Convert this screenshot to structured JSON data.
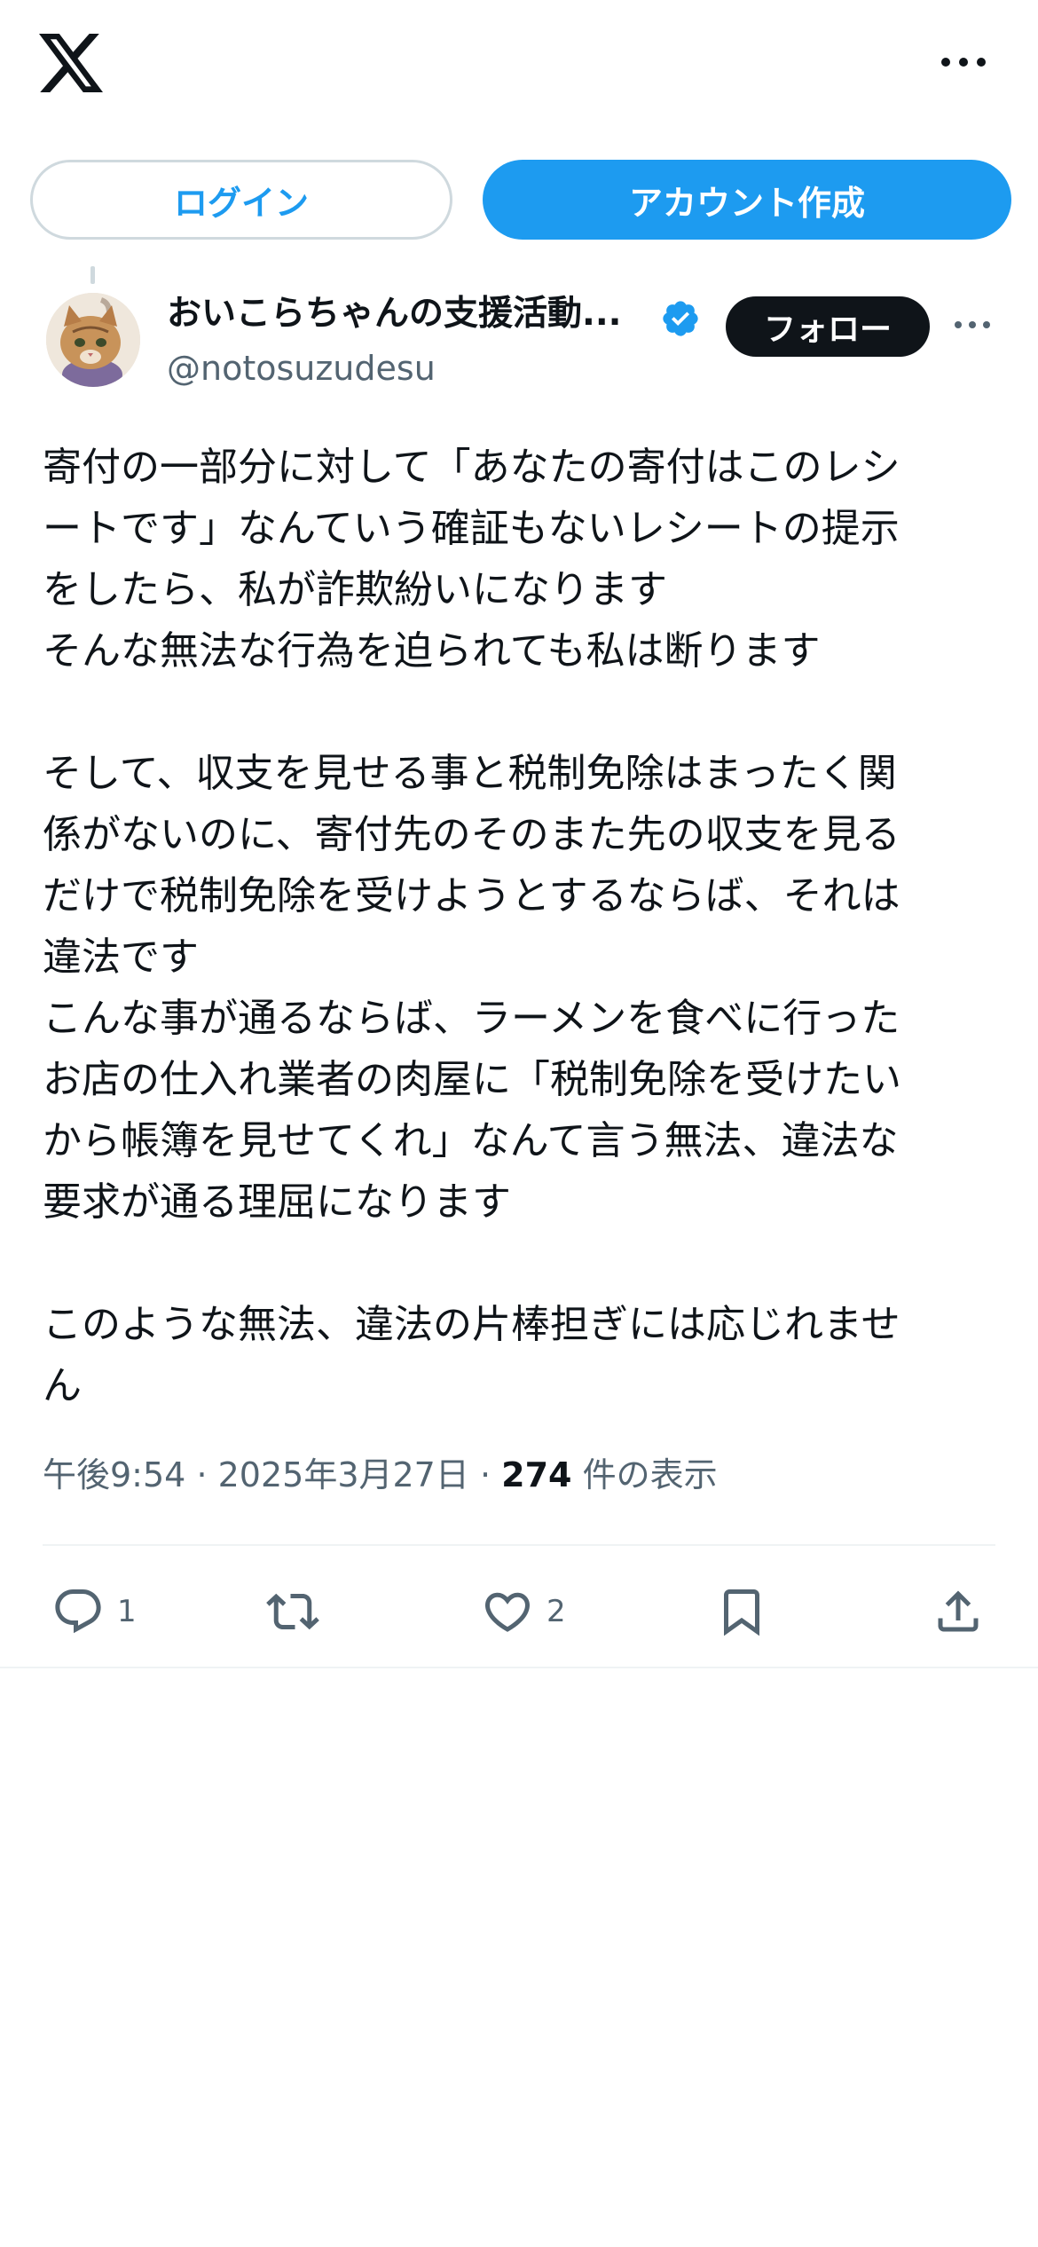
{
  "header": {
    "logo_icon": "x-logo-icon",
    "more_icon": "more-horizontal-icon"
  },
  "auth": {
    "login_label": "ログイン",
    "signup_label": "アカウント作成"
  },
  "author": {
    "display_name": "おいこらちゃんの支援活動...",
    "handle": "@notosuzudesu",
    "verified": true,
    "follow_label": "フォロー"
  },
  "tweet": {
    "paragraphs": [
      "寄付の一部分に対して「あなたの寄付はこのレシ\nートです」なんていう確証もないレシートの提示\nをしたら、私が詐欺紛いになります\nそんな無法な行為を迫られても私は断ります",
      "そして、収支を見せる事と税制免除はまったく関\n係がないのに、寄付先のそのまた先の収支を見る\nだけで税制免除を受けようとするならば、それは\n違法です\nこんな事が通るならば、ラーメンを食べに行った\nお店の仕入れ業者の肉屋に「税制免除を受けたい\nから帳簿を見せてくれ」なんて言う無法、違法な\n要求が通る理屈になります",
      "このような無法、違法の片棒担ぎには応じれませ\nん"
    ],
    "time": "午後9:54",
    "date": "2025年3月27日",
    "separator": "·",
    "views_count": "274",
    "views_label": "件の表示"
  },
  "actions": {
    "reply_count": "1",
    "like_count": "2"
  },
  "colors": {
    "accent": "#1d9bf0",
    "text": "#0f1419",
    "secondary": "#536471",
    "border": "#cfd9de"
  }
}
